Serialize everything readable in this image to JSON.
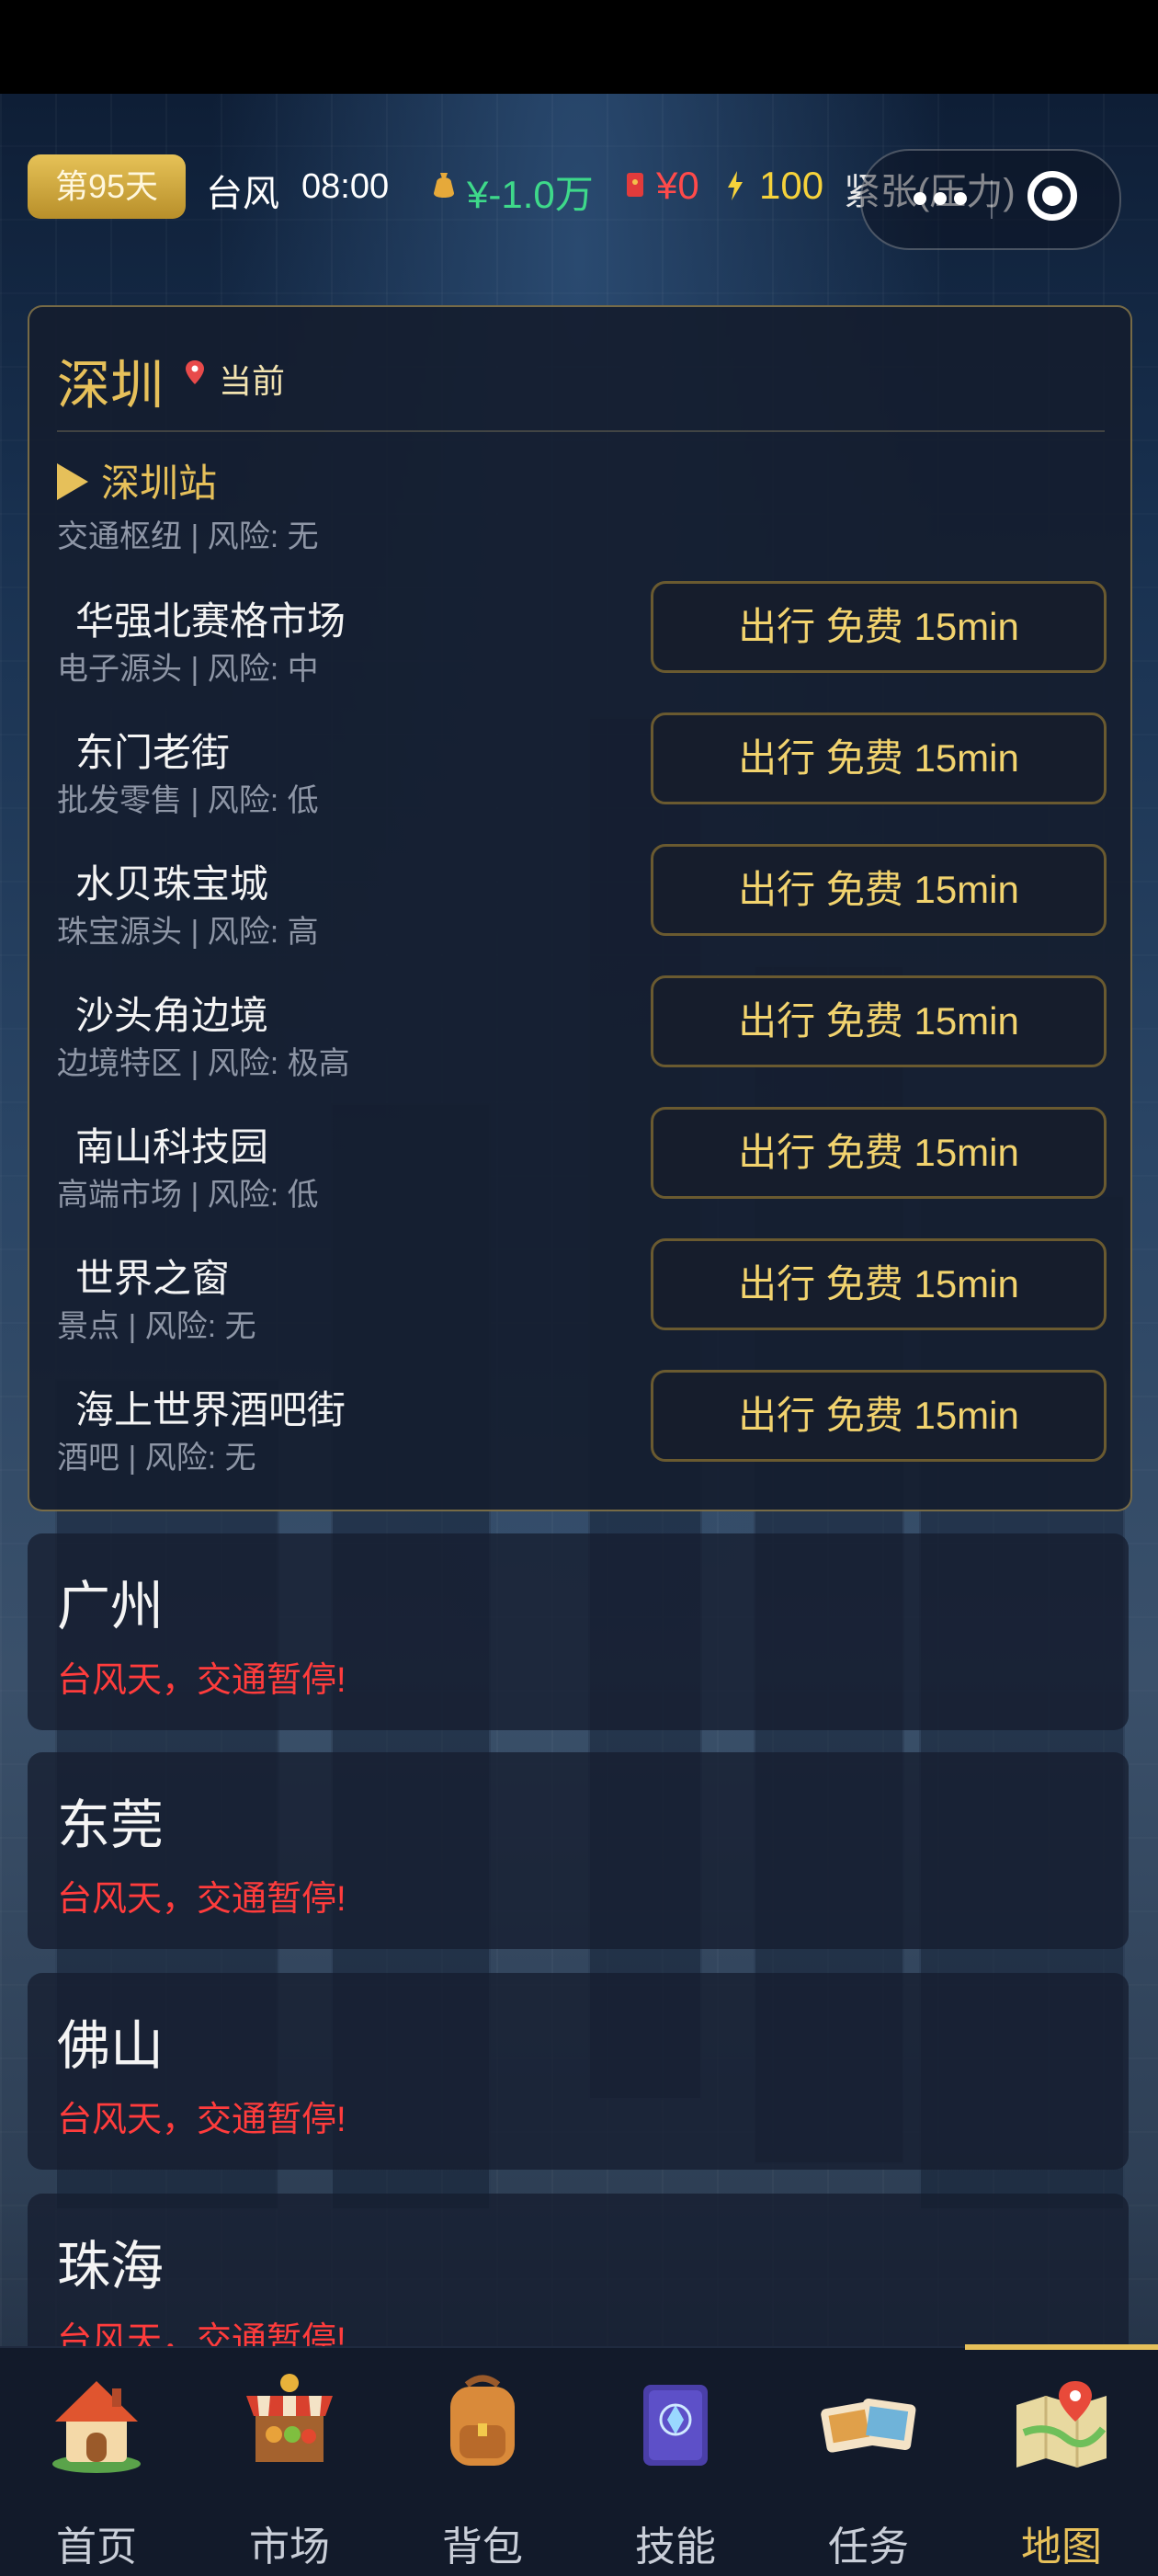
{
  "status_bar": {
    "day": "第95天",
    "weather": "台风",
    "time": "08:00",
    "money": "¥-1.0万",
    "debt": "¥0",
    "energy": "100",
    "stress": "紧张(压力)"
  },
  "capsule": {
    "more_icon": "more-dots-icon",
    "close_icon": "target-circle-icon"
  },
  "current_city": {
    "name": "深圳",
    "tag": "当前",
    "station": {
      "name": "深圳站",
      "meta": "交通枢纽 | 风险: 无"
    },
    "locations": [
      {
        "name": "华强北赛格市场",
        "meta": "电子源头 | 风险: 中",
        "button": "出行 免费 15min"
      },
      {
        "name": "东门老街",
        "meta": "批发零售 | 风险: 低",
        "button": "出行 免费 15min"
      },
      {
        "name": "水贝珠宝城",
        "meta": "珠宝源头 | 风险: 高",
        "button": "出行 免费 15min"
      },
      {
        "name": "沙头角边境",
        "meta": "边境特区 | 风险: 极高",
        "button": "出行 免费 15min"
      },
      {
        "name": "南山科技园",
        "meta": "高端市场 | 风险: 低",
        "button": "出行 免费 15min"
      },
      {
        "name": "世界之窗",
        "meta": "景点 | 风险: 无",
        "button": "出行 免费 15min"
      },
      {
        "name": "海上世界酒吧街",
        "meta": "酒吧 | 风险: 无",
        "button": "出行 免费 15min"
      }
    ]
  },
  "other_cities": [
    {
      "name": "广州",
      "warning": "台风天，交通暂停!"
    },
    {
      "name": "东莞",
      "warning": "台风天，交通暂停!"
    },
    {
      "name": "佛山",
      "warning": "台风天，交通暂停!"
    },
    {
      "name": "珠海",
      "warning": "台风天，交通暂停!"
    }
  ],
  "nav": [
    {
      "label": "首页",
      "icon": "house-icon"
    },
    {
      "label": "市场",
      "icon": "market-stall-icon"
    },
    {
      "label": "背包",
      "icon": "backpack-icon"
    },
    {
      "label": "技能",
      "icon": "skill-book-icon"
    },
    {
      "label": "任务",
      "icon": "task-photos-icon"
    },
    {
      "label": "地图",
      "icon": "map-icon",
      "active": true
    }
  ],
  "colors": {
    "gold": "#e6c05a",
    "money_green": "#3ed98a",
    "warning_red": "#ff3c3c",
    "panel_bg": "#151d2f"
  }
}
